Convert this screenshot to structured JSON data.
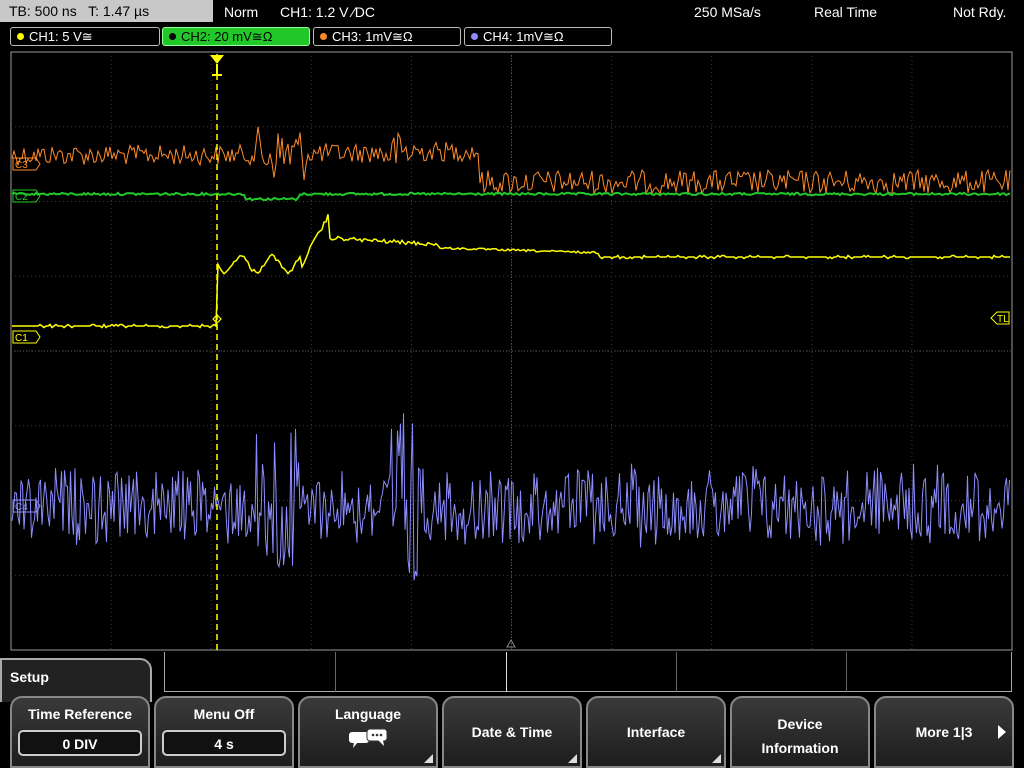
{
  "header": {
    "timebase": "TB: 500 ns   T: 1.47 µs",
    "trigger_mode": "Norm",
    "trigger_info": "CH1: 1.2 V ∕DC",
    "sample_rate": "250 MSa/s",
    "acq_mode": "Real Time",
    "status": "Not Rdy."
  },
  "channels": [
    {
      "label": "CH1: 5 V≅",
      "color": "#ffff00",
      "active": false
    },
    {
      "label": "CH2: 20 mV≅Ω",
      "color": "#22c82a",
      "active": true
    },
    {
      "label": "CH3: 1mV≅Ω",
      "color": "#ff8c2a",
      "active": false
    },
    {
      "label": "CH4: 1mV≅Ω",
      "color": "#8c8cff",
      "active": false
    }
  ],
  "markers": {
    "ch1": "C1",
    "ch2": "C2",
    "ch3": "C3",
    "ch4": "C4",
    "trigger_level": "TL",
    "trigger_pos": "T"
  },
  "menu": {
    "title": "Setup",
    "keys": [
      {
        "label": "Time Reference",
        "value": "0 DIV"
      },
      {
        "label": "Menu Off",
        "value": "4 s"
      },
      {
        "label": "Language",
        "icon": "speech-bubbles-icon"
      },
      {
        "label": "Date & Time"
      },
      {
        "label": "Interface"
      },
      {
        "label": "Device Information",
        "line1": "Device",
        "line2": "Information"
      },
      {
        "label": "More 1|3"
      }
    ]
  }
}
